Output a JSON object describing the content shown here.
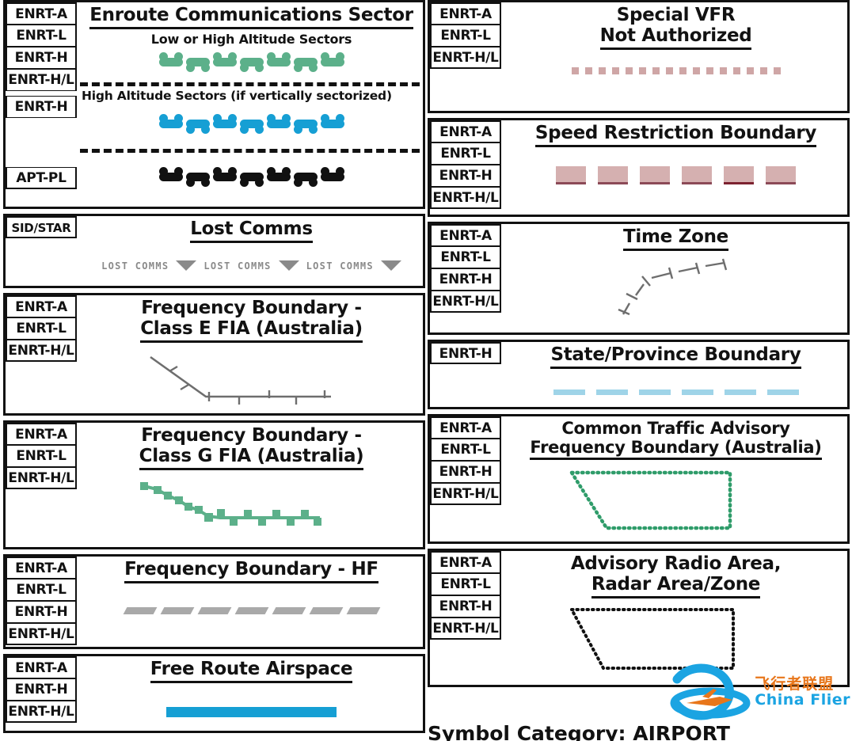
{
  "colors": {
    "green": "#5cb08a",
    "blue": "#169fd4",
    "black": "#111111",
    "gray": "#6e6e6e",
    "gray_light": "#a9a9a9",
    "pink": "#cfa6a6",
    "pink_block": "#d5b0b0",
    "maroon": "#8c4a57",
    "sky": "#9fd4e8",
    "ctaf_green": "#2f9c6a",
    "border": "#111111",
    "watermark_orange": "#e8761b",
    "watermark_blue": "#1ba4e2"
  },
  "bottom_partial_text": "Symbol Category: AIRPORT",
  "watermark": {
    "chinese": "飞行者联盟",
    "english": "China Flier",
    "logo": "airplane-orbit-logo"
  },
  "left_column": [
    {
      "id": "enroute-communications-sector",
      "title": "Enroute Communications Sector",
      "title_underlined": true,
      "labels": [
        "ENRT-A",
        "ENRT-L",
        "ENRT-H",
        "ENRT-H/L"
      ],
      "labels_group2": [
        "ENRT-H"
      ],
      "labels_group3": [
        "APT-PL"
      ],
      "sub1": "Low or High Altitude Sectors",
      "sub2": "High Altitude Sectors (if vertically sectorized)",
      "symbol1": "comm-sector-arc-chain-green",
      "symbol2": "comm-sector-arc-chain-blue",
      "symbol3": "comm-sector-arc-chain-black"
    },
    {
      "id": "lost-comms",
      "title": "Lost Comms",
      "title_underlined": true,
      "labels": [
        "SID/STAR"
      ],
      "symbol": "lost-comms-arrow-chain",
      "symbol_text": "LOST COMMS",
      "symbol_repeat": 3
    },
    {
      "id": "frequency-boundary-class-e-fia",
      "title_line1": "Frequency Boundary -",
      "title_line2": "Class E FIA (Australia)",
      "labels": [
        "ENRT-A",
        "ENRT-L",
        "ENRT-H/L"
      ],
      "symbol": "tick-polyline-gray"
    },
    {
      "id": "frequency-boundary-class-g-fia",
      "title_line1": "Frequency Boundary -",
      "title_line2": "Class G FIA (Australia)",
      "labels": [
        "ENRT-A",
        "ENRT-L",
        "ENRT-H/L"
      ],
      "symbol": "square-chain-polyline-green"
    },
    {
      "id": "frequency-boundary-hf",
      "title": "Frequency Boundary - HF",
      "title_underlined": true,
      "labels": [
        "ENRT-A",
        "ENRT-L",
        "ENRT-H",
        "ENRT-H/L"
      ],
      "symbol": "slanted-dash-line-gray"
    },
    {
      "id": "free-route-airspace",
      "title": "Free Route Airspace",
      "title_underlined": true,
      "labels": [
        "ENRT-A",
        "ENRT-H",
        "ENRT-H/L"
      ],
      "symbol": "solid-thick-bar-blue"
    }
  ],
  "right_column": [
    {
      "id": "special-vfr-not-authorized",
      "title_line1": "Special VFR",
      "title_line2": "Not Authorized",
      "labels": [
        "ENRT-A",
        "ENRT-L",
        "ENRT-H/L"
      ],
      "symbol": "dotted-square-line-pink"
    },
    {
      "id": "speed-restriction-boundary",
      "title": "Speed Restriction Boundary",
      "title_underlined": true,
      "labels": [
        "ENRT-A",
        "ENRT-L",
        "ENRT-H",
        "ENRT-H/L"
      ],
      "symbol": "pink-block-dash-line"
    },
    {
      "id": "time-zone",
      "title": "Time Zone",
      "title_underlined": true,
      "labels": [
        "ENRT-A",
        "ENRT-L",
        "ENRT-H",
        "ENRT-H/L"
      ],
      "symbol": "ticked-dashed-curve-gray"
    },
    {
      "id": "state-province-boundary",
      "title": "State/Province Boundary",
      "title_underlined": true,
      "labels": [
        "ENRT-H"
      ],
      "symbol": "dashed-line-sky-blue"
    },
    {
      "id": "common-traffic-advisory-frequency-boundary",
      "title_line1": "Common Traffic Advisory",
      "title_line2": "Frequency Boundary (Australia)",
      "labels": [
        "ENRT-A",
        "ENRT-L",
        "ENRT-H",
        "ENRT-H/L"
      ],
      "symbol": "dotted-polygon-green"
    },
    {
      "id": "advisory-radio-area",
      "title_line1": "Advisory Radio Area,",
      "title_line2": "Radar Area/Zone",
      "labels": [
        "ENRT-A",
        "ENRT-L",
        "ENRT-H",
        "ENRT-H/L"
      ],
      "symbol": "dotted-polygon-black"
    }
  ]
}
